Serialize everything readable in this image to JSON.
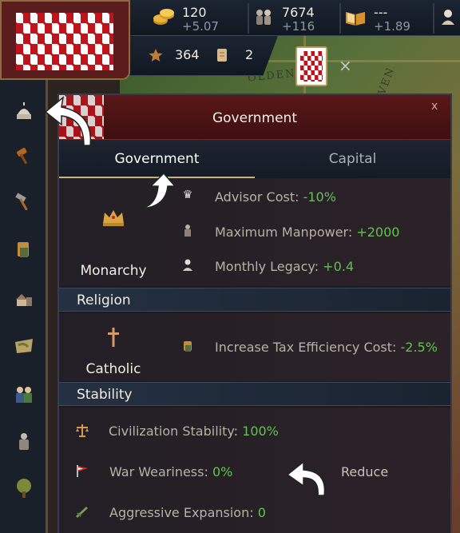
{
  "topbar": {
    "gold": {
      "icon": "gold-coins-icon",
      "value": "120",
      "delta": "+5.07"
    },
    "manpower": {
      "icon": "soldiers-icon",
      "value": "7674",
      "delta": "+116"
    },
    "research": {
      "icon": "book-icon",
      "value": "---",
      "delta": "+1.89"
    },
    "legacy_icon": "bust-icon"
  },
  "subbar": {
    "prestige": {
      "icon": "star-icon",
      "value": "364"
    },
    "documents": {
      "icon": "scroll-icon",
      "value": "2"
    }
  },
  "map_labels": [
    "OLDENB",
    "HAVEN"
  ],
  "sidebar": {
    "items": [
      {
        "icon": "capitol-dome-icon"
      },
      {
        "icon": "gavel-icon"
      },
      {
        "icon": "hammer-icon"
      },
      {
        "icon": "ledger-icon"
      },
      {
        "icon": "town-icon"
      },
      {
        "icon": "map-icon"
      },
      {
        "icon": "diplomats-icon"
      },
      {
        "icon": "soldier-icon"
      },
      {
        "icon": "tree-icon"
      }
    ]
  },
  "panel": {
    "title": "Government",
    "close_label": "x",
    "tabs": {
      "government": "Government",
      "capital": "Capital"
    },
    "government": {
      "type": "Monarchy",
      "icon": "crown-icon",
      "modifiers": [
        {
          "icon": "crown-small-icon",
          "label": "Advisor Cost: ",
          "value": "-10%"
        },
        {
          "icon": "soldier-small-icon",
          "label": "Maximum Manpower: ",
          "value": "+2000"
        },
        {
          "icon": "bust-small-icon",
          "label": "Monthly Legacy: ",
          "value": "+0.4"
        }
      ]
    },
    "religion": {
      "heading": "Religion",
      "name": "Catholic",
      "icon": "cross-icon",
      "modifiers": [
        {
          "icon": "tax-icon",
          "label": "Increase Tax Efficiency Cost: ",
          "value": "-2.5%"
        }
      ]
    },
    "stability": {
      "heading": "Stability",
      "items": [
        {
          "icon": "scales-icon",
          "label": "Civilization Stability: ",
          "value": "100%"
        },
        {
          "icon": "war-flag-icon",
          "label": "War Weariness: ",
          "value": "0%"
        },
        {
          "icon": "sword-icon",
          "label": "Aggressive Expansion: ",
          "value": "0"
        }
      ],
      "reduce_label": "Reduce"
    }
  }
}
